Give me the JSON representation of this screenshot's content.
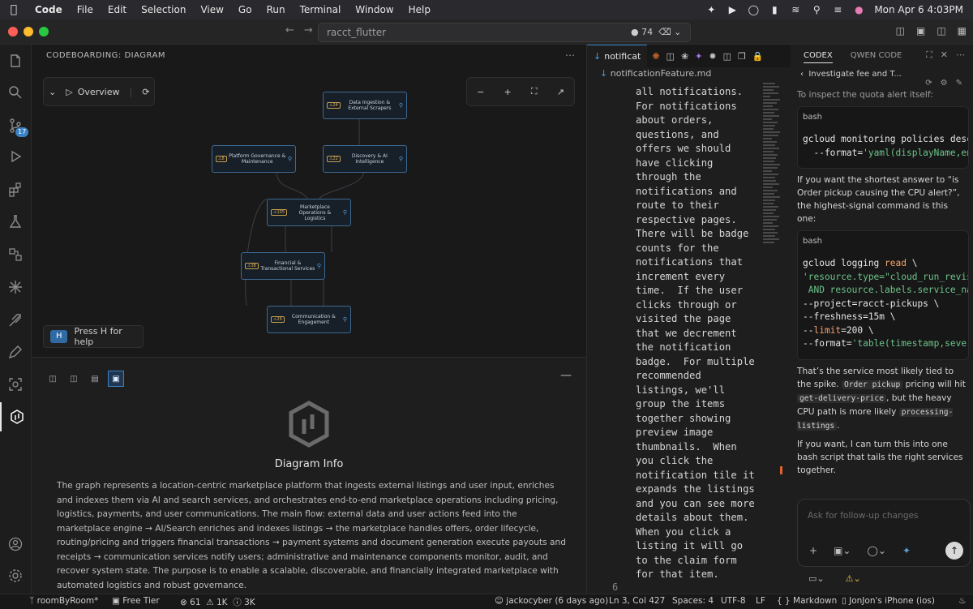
{
  "menubar": {
    "app_name": "Code",
    "items": [
      "File",
      "Edit",
      "Selection",
      "View",
      "Go",
      "Run",
      "Terminal",
      "Window",
      "Help"
    ],
    "clock": "Mon Apr 6  4:03PM"
  },
  "titlebar": {
    "search_text": "racct_flutter",
    "changes_count": "74"
  },
  "activitybar": {
    "source_control_badge": "17"
  },
  "diagram_panel": {
    "header": "CODEBOARDING: DIAGRAM",
    "overview_label": "Overview",
    "help_key": "H",
    "help_text": "Press H for help",
    "nodes": [
      {
        "label": "Data Ingestion & External Scrapers",
        "count": "24"
      },
      {
        "label": "Platform Governance & Maintenance",
        "count": "8"
      },
      {
        "label": "Discovery & AI Intelligence",
        "count": "22"
      },
      {
        "label": "Marketplace Operations & Logistics",
        "count": "105"
      },
      {
        "label": "Financial & Transactional Services",
        "count": "38"
      },
      {
        "label": "Communication & Engagement",
        "count": "29"
      }
    ]
  },
  "info_panel": {
    "title": "Diagram Info",
    "description": "The graph represents a location-centric marketplace platform that ingests external listings and user input, enriches and indexes them via AI and search services, and orchestrates end-to-end marketplace operations including pricing, logistics, payments, and user communications. The main flow: external data and user actions feed into the marketplace engine → AI/Search enriches and indexes listings → the marketplace handles offers, order lifecycle, routing/pricing and triggers financial transactions → payment systems and document generation execute payouts and receipts → communication services notify users; administrative and maintenance components monitor, audit, and recover system state. The purpose is to enable a scalable, discoverable, and financially integrated marketplace with automated logistics and robust governance."
  },
  "editor": {
    "tab_label": "notificat",
    "breadcrumb": "notificationFeature.md",
    "code_lines": [
      "all notifications.",
      "For notifications",
      "about orders,",
      "questions, and",
      "offers we should",
      "have clicking",
      "through the",
      "notifications and",
      "route to their",
      "respective pages.",
      "There will be badge",
      "counts for the",
      "notifications that",
      "increment every",
      "time.  If the user",
      "clicks through or",
      "visited the page",
      "that we decrement",
      "the notification",
      "badge.  For multiple",
      "recommended",
      "listings, we'll",
      "group the items",
      "together showing",
      "preview image",
      "thumbnails.  When",
      "you click the",
      "notification tile it",
      "expands the listings",
      "and you can see more",
      "details about them.",
      "When you click a",
      "listing it will go",
      "to the claim form",
      "for that item."
    ],
    "line_number": "6"
  },
  "right_panel": {
    "tabs": [
      "CODEX",
      "QWEN CODE"
    ],
    "thread_title": "Investigate fee and T...",
    "intro_text": "To inspect the quota alert itself:",
    "code1_lang": "bash",
    "code1_lines": [
      {
        "a": "gcloud monitoring policies desc",
        "b": "",
        "c": ""
      },
      {
        "a": "  --format=",
        "b": "'yaml(displayName,en",
        "c": ""
      }
    ],
    "para1": "If you want the shortest answer to “is Order pickup causing the CPU alert?”, the highest-signal command is this one:",
    "code2_lang": "bash",
    "code2_lines": [
      {
        "a": "gcloud logging ",
        "b": "read",
        "c": " \\"
      },
      {
        "a": "",
        "b": "'resource.type=\"cloud_run_revis",
        "c": ""
      },
      {
        "a": "",
        "b": " AND resource.labels.service_na",
        "c": ""
      },
      {
        "a": "--project=racct-pickups \\",
        "b": "",
        "c": ""
      },
      {
        "a": "--freshness=15m \\",
        "b": "",
        "c": ""
      },
      {
        "a": "--",
        "b": "limit",
        "c": "=200 \\"
      },
      {
        "a": "--format=",
        "b": "'table(timestamp,sever",
        "c": ""
      }
    ],
    "para2_a": "That’s the service most likely tied to the spike. ",
    "para2_code1": "Order pickup",
    "para2_b": " pricing will hit ",
    "para2_code2": "get-delivery-price",
    "para2_c": ", but the heavy CPU path is more likely ",
    "para2_code3": "processing-listings",
    "para2_d": ".",
    "para3": "If you want, I can turn this into one bash script that tails the right services together.",
    "composer_placeholder": "Ask for follow-up changes"
  },
  "statusbar": {
    "branch": "roomByRoom*",
    "tier": "Free Tier",
    "problems_1": "61",
    "problems_2": "1K",
    "problems_3": "3K",
    "blame": "jackocyber (6 days ago)",
    "position": "Ln 3, Col 427",
    "spaces": "Spaces: 4",
    "encoding": "UTF-8",
    "eol": "LF",
    "language": "Markdown",
    "device": "JonJon's iPhone (ios)"
  }
}
